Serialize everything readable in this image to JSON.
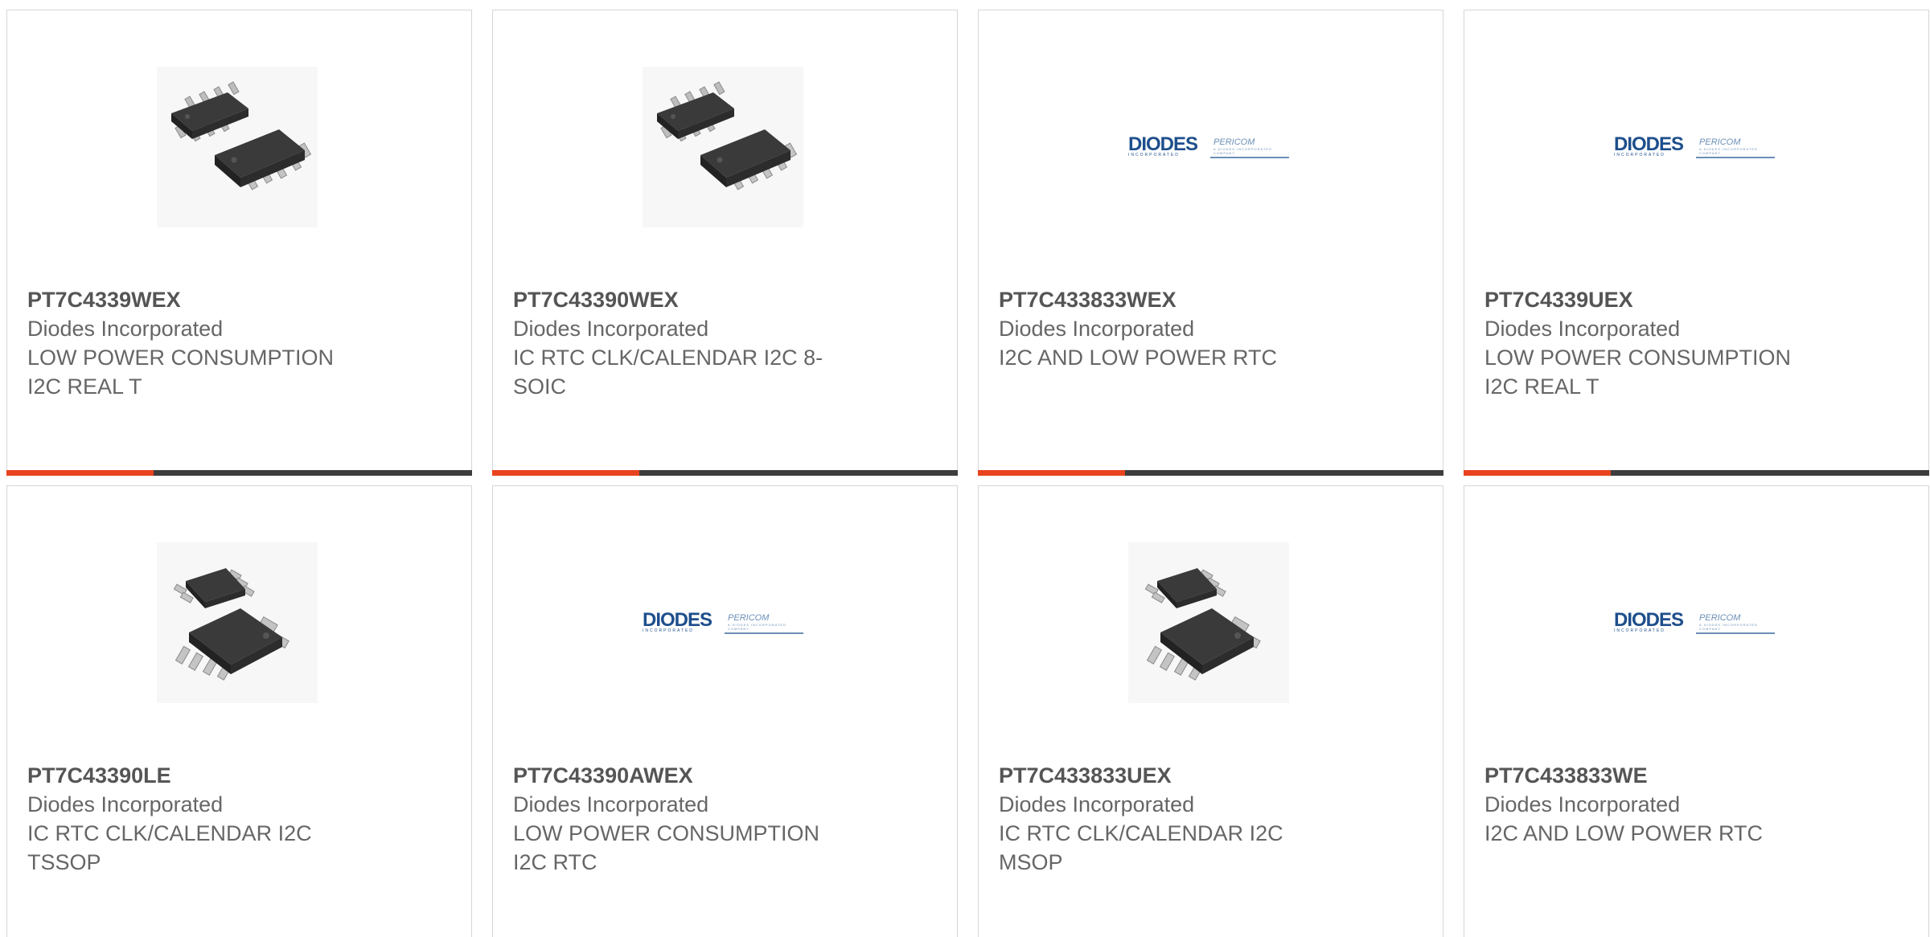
{
  "colors": {
    "accent": "#e8431e",
    "bar": "#3d3d3d",
    "diodes_blue": "#1e4f8c",
    "pericom_blue": "#6b8fb7"
  },
  "logo": {
    "diodes": "DIODES",
    "diodes_sub": "INCORPORATED",
    "pericom": "PERICOM",
    "pericom_sub": "A DIODES INCORPORATED COMPANY"
  },
  "products": [
    {
      "part_number": "PT7C4339WEX",
      "manufacturer": "Diodes Incorporated",
      "description": "LOW POWER CONSUMPTION I2C REAL T",
      "image": "soic-8-package"
    },
    {
      "part_number": "PT7C43390WEX",
      "manufacturer": "Diodes Incorporated",
      "description": "IC RTC CLK/CALENDAR I2C 8-SOIC",
      "image": "soic-8-package"
    },
    {
      "part_number": "PT7C433833WEX",
      "manufacturer": "Diodes Incorporated",
      "description": "I2C AND LOW POWER RTC",
      "image": "diodes-pericom-logo"
    },
    {
      "part_number": "PT7C4339UEX",
      "manufacturer": "Diodes Incorporated",
      "description": "LOW POWER CONSUMPTION I2C REAL T",
      "image": "diodes-pericom-logo"
    },
    {
      "part_number": "PT7C43390LE",
      "manufacturer": "Diodes Incorporated",
      "description": "IC RTC CLK/CALENDAR I2C TSSOP",
      "image": "msop-package"
    },
    {
      "part_number": "PT7C43390AWEX",
      "manufacturer": "Diodes Incorporated",
      "description": "LOW POWER CONSUMPTION I2C RTC",
      "image": "diodes-pericom-logo"
    },
    {
      "part_number": "PT7C433833UEX",
      "manufacturer": "Diodes Incorporated",
      "description": "IC RTC CLK/CALENDAR I2C MSOP",
      "image": "msop-package"
    },
    {
      "part_number": "PT7C433833WE",
      "manufacturer": "Diodes Incorporated",
      "description": "I2C AND LOW POWER RTC",
      "image": "diodes-pericom-logo"
    }
  ]
}
